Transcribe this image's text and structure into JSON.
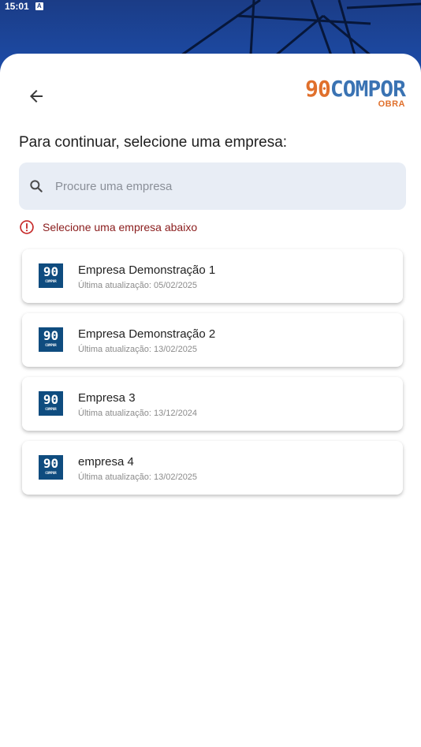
{
  "status": {
    "time": "15:01",
    "badge": "A"
  },
  "header": {
    "logo_number": "90",
    "logo_word": "COMPOR",
    "logo_sub": "OBRA"
  },
  "heading": "Para continuar, selecione uma empresa:",
  "search": {
    "placeholder": "Procure uma empresa",
    "value": ""
  },
  "error": "Selecione uma empresa abaixo",
  "companies": [
    {
      "name": "Empresa Demonstração 1",
      "updated": "Última atualização: 05/02/2025",
      "logo_number": "90",
      "logo_word": "COMPOR"
    },
    {
      "name": "Empresa Demonstração 2",
      "updated": "Última atualização: 13/02/2025",
      "logo_number": "90",
      "logo_word": "COMPOR"
    },
    {
      "name": "Empresa 3",
      "updated": "Última atualização: 13/12/2024",
      "logo_number": "90",
      "logo_word": "COMPOR"
    },
    {
      "name": "empresa 4",
      "updated": "Última atualização: 13/02/2025",
      "logo_number": "90",
      "logo_word": "COMPOR"
    }
  ],
  "colors": {
    "accent_orange": "#e0702c",
    "accent_blue": "#3a73b3",
    "error": "#c62828",
    "card_logo": "#0f4c7f"
  }
}
